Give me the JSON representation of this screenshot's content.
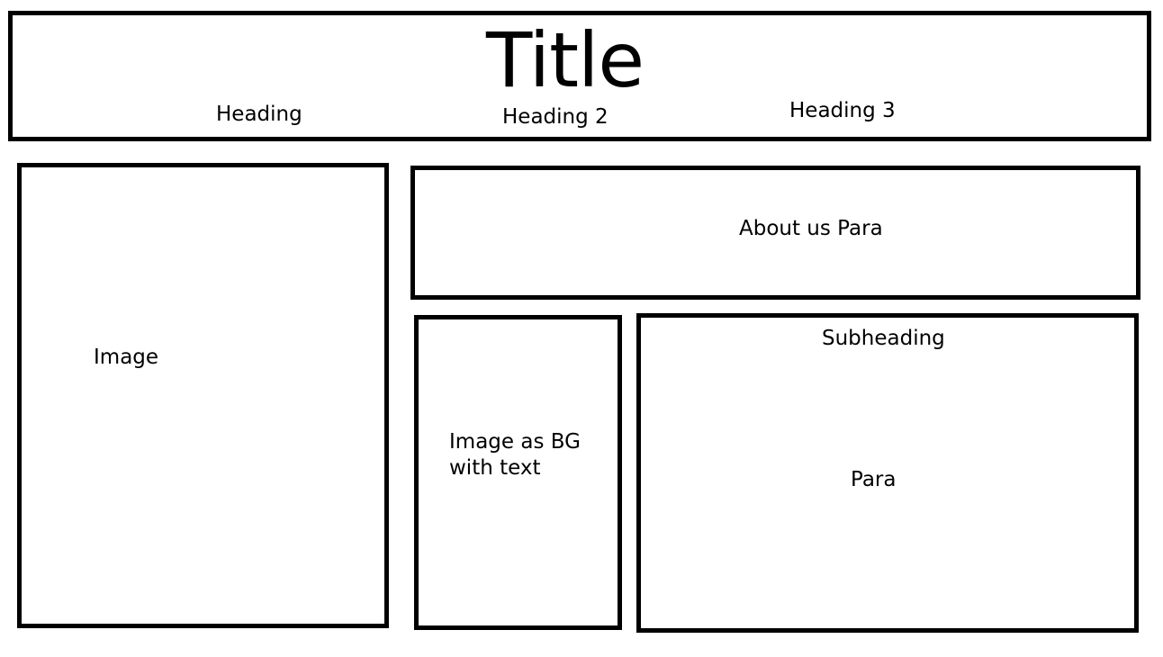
{
  "header": {
    "title": "Title",
    "headings": [
      "Heading",
      "Heading 2",
      "Heading 3"
    ]
  },
  "left_panel": {
    "label": "Image"
  },
  "about_panel": {
    "label": "About us Para"
  },
  "bg_panel": {
    "label": "Image as BG with text"
  },
  "content_panel": {
    "subheading": "Subheading",
    "para": "Para"
  },
  "colors": {
    "border": "#000000",
    "background": "#ffffff",
    "text": "#000000"
  }
}
